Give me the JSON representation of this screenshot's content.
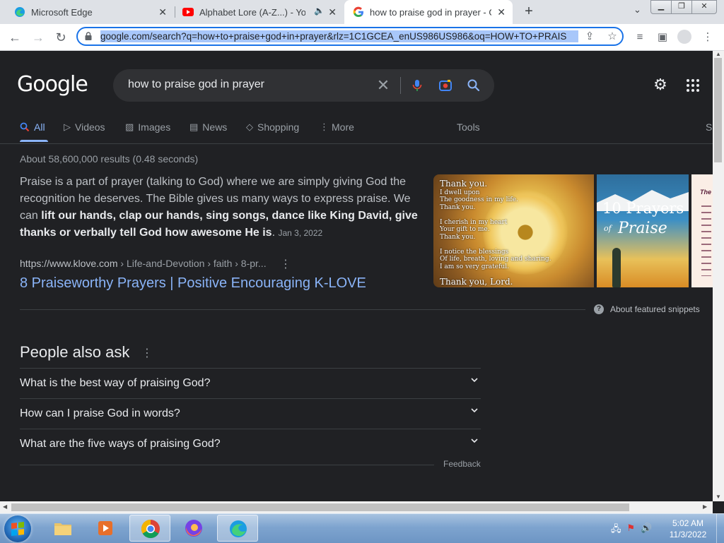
{
  "browser": {
    "tabs": [
      {
        "title": "Microsoft Edge",
        "icon": "edge-icon"
      },
      {
        "title": "Alphabet Lore (A-Z...) - YouTu",
        "icon": "youtube-icon"
      },
      {
        "title": "how to praise god in prayer - Go",
        "icon": "google-icon",
        "active": true
      }
    ],
    "url": "google.com/search?q=how+to+praise+god+in+prayer&rlz=1C1GCEA_enUS986US986&oq=HOW+TO+PRAIS"
  },
  "google": {
    "logo": "Google",
    "query": "how to praise god in prayer",
    "nav": [
      "All",
      "Videos",
      "Images",
      "News",
      "Shopping",
      "More",
      "Tools",
      "S"
    ],
    "stats": "About 58,600,000 results (0.48 seconds)",
    "snippet": {
      "text_start": "Praise is a part of prayer (talking to God) where we are simply giving God the recognition he deserves. The Bible gives us many ways to express praise. We can ",
      "text_bold": "lift our hands, clap our hands, sing songs, dance like King David, give thanks or verbally tell God how awesome He is",
      "text_end": ".",
      "date": "Jan 3, 2022"
    },
    "result": {
      "site": "https://www.klove.com",
      "path": " › Life-and-Devotion › faith › 8-pr...",
      "title": "8 Praiseworthy Prayers | Positive Encouraging K-LOVE"
    },
    "images": {
      "img1_lines": [
        "Thank you.",
        "I dwell upon",
        "The goodness in my life.",
        "Thank you.",
        "I cherish in my heart",
        "Your gift to me.",
        "Thank you.",
        "I notice the blessings",
        "Of life, breath, loving and sharing.",
        "I am so very grateful.",
        "Thank you, Lord."
      ],
      "img2_title_1": "10 Prayers",
      "img2_title_2": "Praise",
      "img2_of": "of",
      "img3_title": "The"
    },
    "about_snippets": "About featured snippets",
    "paa_title": "People also ask",
    "paa_questions": [
      "What is the best way of praising God?",
      "How can I praise God in words?",
      "What are the five ways of praising God?"
    ],
    "feedback": "Feedback"
  },
  "taskbar": {
    "time": "5:02 AM",
    "date": "11/3/2022"
  },
  "colors": {
    "link": "#8ab4f8",
    "page_bg": "#202124",
    "accent": "#1a73e8"
  }
}
